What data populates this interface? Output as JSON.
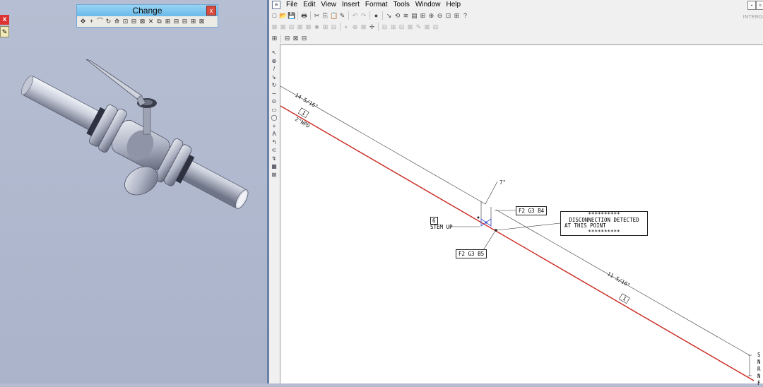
{
  "change_toolbar": {
    "title": "Change",
    "close": "x",
    "tools": [
      "✥",
      "+",
      "⌒",
      "↻",
      "⟰",
      "⊡",
      "⊟",
      "⊠",
      "✕",
      "⧉",
      "⊞",
      "⊟",
      "⊟",
      "⊞",
      "⊠"
    ]
  },
  "left_panel": {
    "close": "x",
    "tool_icon": "pencil-icon"
  },
  "app": {
    "menu": [
      "File",
      "Edit",
      "View",
      "Insert",
      "Format",
      "Tools",
      "Window",
      "Help"
    ],
    "window_min": "-",
    "window_restore": "",
    "brand": "INTERG",
    "toolbar1": [
      "□",
      "📂",
      "💾",
      "🖶",
      "✂",
      "⎘",
      "📋",
      "✎",
      "↶",
      "↷",
      "●",
      "↘",
      "⟲",
      "≋",
      "▤",
      "⊞",
      "⊕",
      "⊖",
      "⊡",
      "⊞",
      "?"
    ],
    "toolbar2": [
      "⊠",
      "⊠",
      "⊟",
      "⊠",
      "⊠",
      "■",
      "⊞",
      "⊟",
      "◐",
      "⊕",
      "⊠",
      "✛",
      "⊟",
      "⊞",
      "⊟",
      "⊠",
      "✎",
      "⊠",
      "⊟"
    ],
    "toolbar3": [
      "⊞",
      "⊟",
      "⊠",
      "⊟"
    ],
    "palette": [
      "↖",
      "⊕",
      "/",
      "↳",
      "↻",
      "∼",
      "⊙",
      "▭",
      "◯",
      "+",
      "A",
      "↰",
      "⊂",
      "↯",
      "▦",
      "⊠"
    ]
  },
  "drawing": {
    "dim_top": "14 5/16\"",
    "dim_bottom": "11 5/16\"",
    "dim_small": "7\"",
    "pipe_tag_1": "1",
    "pipe_tag_2": "1",
    "npd": "2\"NPD",
    "f2_b4": "F2 G3 B4",
    "f2_b5": "F2 G3 B5",
    "tag_6": "6",
    "stem_up": "STEM UP",
    "disc_stars_top": "**********",
    "disc_line1": "DISCONNECTION DETECTED",
    "disc_line2": "AT THIS POINT",
    "disc_stars_bottom": "**********",
    "edge_letters": [
      "S",
      "N",
      "R",
      "N",
      "F"
    ]
  }
}
